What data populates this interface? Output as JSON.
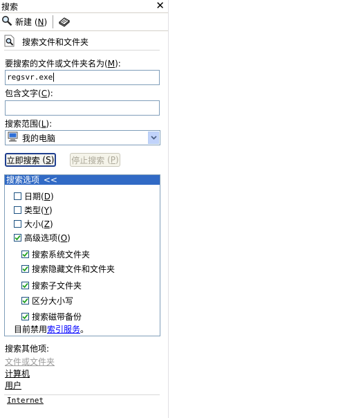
{
  "window": {
    "title": "搜索",
    "close": "✕"
  },
  "toolbar": {
    "new_label": "新建",
    "new_key": "N"
  },
  "heading": "搜索文件和文件夹",
  "fields": {
    "name_label": "要搜索的文件或文件夹名为",
    "name_key": "M",
    "name_value": "regsvr.exe",
    "contains_label": "包含文字",
    "contains_key": "C",
    "contains_value": "",
    "scope_label": "搜索范围",
    "scope_key": "L",
    "scope_value": "我的电脑"
  },
  "buttons": {
    "search_label": "立即搜索",
    "search_key": "S",
    "stop_label": "停止搜索",
    "stop_key": "P"
  },
  "options": {
    "header": "搜索选项",
    "chevron": "<<",
    "items": [
      {
        "label": "日期",
        "key": "D",
        "checked": false
      },
      {
        "label": "类型",
        "key": "Y",
        "checked": false
      },
      {
        "label": "大小",
        "key": "Z",
        "checked": false
      },
      {
        "label": "高级选项",
        "key": "O",
        "checked": true
      }
    ],
    "advanced": [
      {
        "label": "搜索系统文件夹",
        "checked": true
      },
      {
        "label": "搜索隐藏文件和文件夹",
        "checked": true
      },
      {
        "label": "搜索子文件夹",
        "checked": true
      },
      {
        "label": "区分大小写",
        "checked": true
      },
      {
        "label": "搜索磁带备份",
        "checked": true
      }
    ],
    "indexing_prefix": "目前禁用",
    "indexing_link": "索引服务",
    "indexing_suffix": "。"
  },
  "other": {
    "label": "搜索其他项:",
    "files_folders": "文件或文件夹",
    "computers": "计算机",
    "people": "用户",
    "internet": "Internet"
  },
  "colors": {
    "header_blue": "#316ac5",
    "field_border": "#7f9db9",
    "check_green": "#21a121"
  }
}
